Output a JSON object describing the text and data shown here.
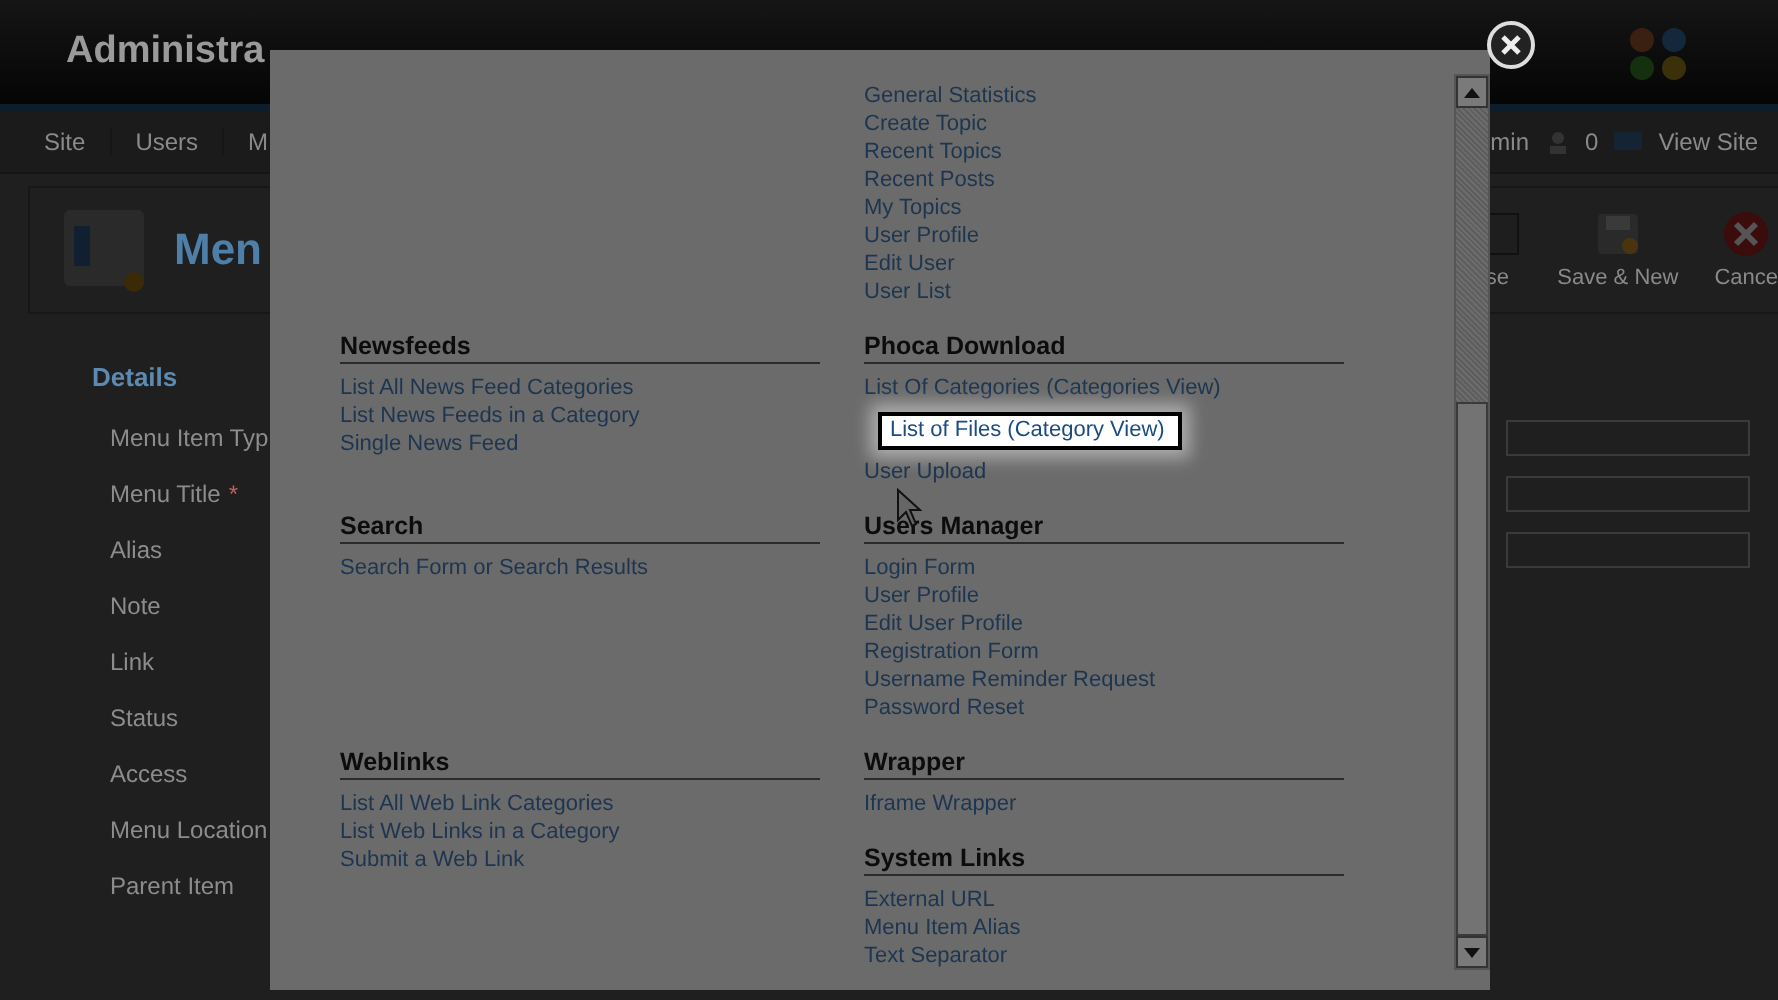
{
  "header": {
    "title": "Administra"
  },
  "menu": {
    "items": [
      "Site",
      "Users",
      "M"
    ],
    "right": [
      {
        "kind": "text",
        "label": "min"
      },
      {
        "kind": "count",
        "label": "0"
      },
      {
        "kind": "link",
        "label": "View Site"
      }
    ]
  },
  "toolbar": {
    "title": "Men",
    "buttons": [
      {
        "kind": "save",
        "label": "se"
      },
      {
        "kind": "save-new",
        "label": "Save & New"
      },
      {
        "kind": "cancel",
        "label": "Cance"
      }
    ]
  },
  "details": {
    "legend": "Details",
    "fields": [
      {
        "label": "Menu Item Typ",
        "input": true
      },
      {
        "label": "Menu Title",
        "mark": "*",
        "input": true
      },
      {
        "label": "Alias",
        "input": true
      },
      {
        "label": "Note",
        "input": false
      },
      {
        "label": "Link",
        "input": false
      },
      {
        "label": "Status",
        "input": false
      },
      {
        "label": "Access",
        "input": false
      },
      {
        "label": "Menu Location",
        "input": false
      },
      {
        "label": "Parent Item",
        "input": false
      }
    ]
  },
  "modal": {
    "rows": [
      {
        "left": [],
        "right": [
          {
            "items": [
              "General Statistics",
              "Create Topic",
              "Recent Topics",
              "Recent Posts",
              "My Topics",
              "User Profile",
              "Edit User",
              "User List"
            ]
          }
        ]
      },
      {
        "left": [
          {
            "title": "Newsfeeds",
            "items": [
              "List All News Feed Categories",
              "List News Feeds in a Category",
              "Single News Feed"
            ]
          }
        ],
        "right": [
          {
            "title": "Phoca Download",
            "items": [
              "List Of Categories (Categories View)",
              {
                "kind": "tooltip",
                "label": "List of Files (Category View)"
              },
              "User Upload"
            ]
          }
        ]
      },
      {
        "left": [
          {
            "title": "Search",
            "items": [
              "Search Form or Search Results"
            ]
          }
        ],
        "right": [
          {
            "title": "Users Manager",
            "items": [
              "Login Form",
              "User Profile",
              "Edit User Profile",
              "Registration Form",
              "Username Reminder Request",
              "Password Reset"
            ]
          }
        ]
      },
      {
        "left": [
          {
            "title": "Weblinks",
            "items": [
              "List All Web Link Categories",
              "List Web Links in a Category",
              "Submit a Web Link"
            ]
          }
        ],
        "right": [
          {
            "title": "Wrapper",
            "items": [
              "Iframe Wrapper"
            ]
          },
          {
            "title": "System Links",
            "items": [
              "External URL",
              "Menu Item Alias",
              "Text Separator"
            ]
          }
        ]
      }
    ]
  }
}
